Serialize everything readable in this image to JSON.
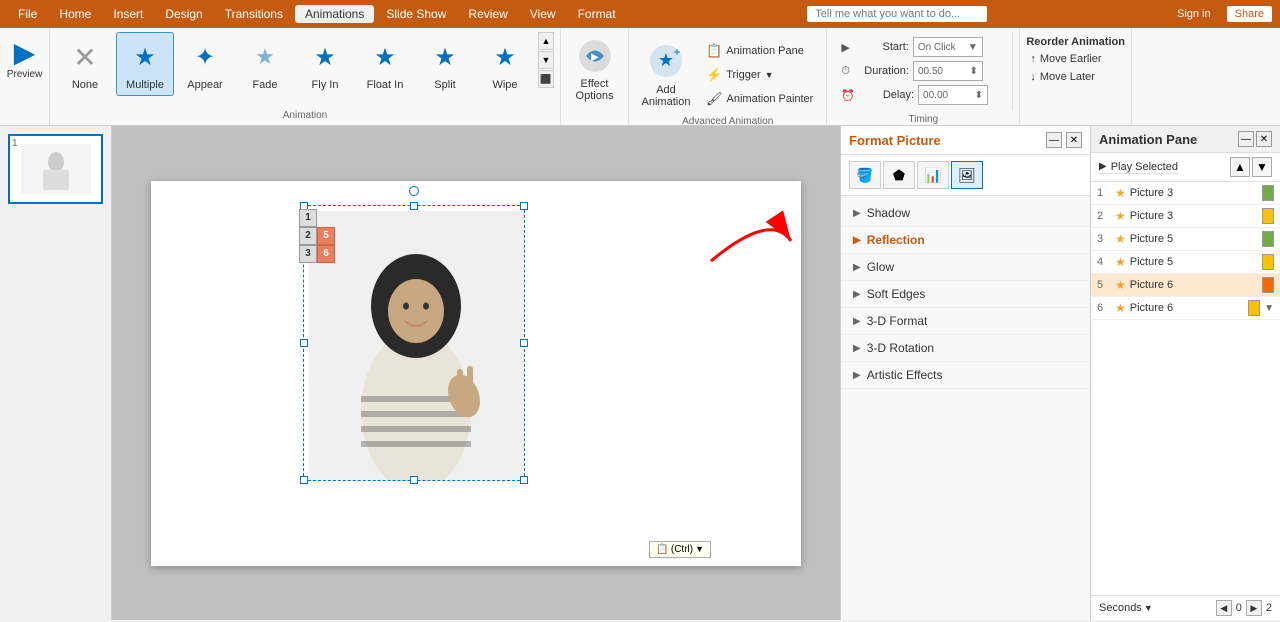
{
  "menubar": {
    "items": [
      "File",
      "Home",
      "Insert",
      "Design",
      "Transitions",
      "Animations",
      "Slide Show",
      "Review",
      "View",
      "Format"
    ],
    "active": "Animations",
    "search_placeholder": "Tell me what you want to do...",
    "signin": "Sign in",
    "share": "Share"
  },
  "ribbon": {
    "groups": {
      "preview": {
        "label": "Preview"
      },
      "animation": {
        "label": "Animation",
        "items": [
          {
            "id": "none",
            "label": "None",
            "icon": "✕"
          },
          {
            "id": "multiple",
            "label": "Multiple",
            "icon": "★",
            "selected": true
          },
          {
            "id": "appear",
            "label": "Appear",
            "icon": "✦"
          },
          {
            "id": "fade",
            "label": "Fade",
            "icon": "◈"
          },
          {
            "id": "fly-in",
            "label": "Fly In",
            "icon": "★"
          },
          {
            "id": "float-in",
            "label": "Float In",
            "icon": "★"
          },
          {
            "id": "split",
            "label": "Split",
            "icon": "★"
          },
          {
            "id": "wipe",
            "label": "Wipe",
            "icon": "★"
          }
        ]
      },
      "effect-options": {
        "label": "Effect Options"
      },
      "advanced": {
        "label": "Advanced Animation",
        "items": [
          {
            "id": "add-animation",
            "label": "Add Animation"
          },
          {
            "id": "animation-pane",
            "label": "Animation Pane"
          },
          {
            "id": "trigger",
            "label": "Trigger"
          },
          {
            "id": "animation-painter",
            "label": "Animation Painter"
          }
        ]
      },
      "timing": {
        "label": "Timing",
        "start_label": "Start:",
        "start_value": "On Click",
        "duration_label": "Duration:",
        "duration_value": "00.50",
        "delay_label": "Delay:",
        "delay_value": "00.00"
      },
      "reorder": {
        "title": "Reorder Animation",
        "move_earlier": "Move Earlier",
        "move_later": "Move Later"
      }
    }
  },
  "format_panel": {
    "title": "Format Picture",
    "sections": [
      {
        "id": "shadow",
        "label": "Shadow",
        "expanded": false,
        "bold": false
      },
      {
        "id": "reflection",
        "label": "Reflection",
        "expanded": false,
        "bold": true
      },
      {
        "id": "glow",
        "label": "Glow",
        "expanded": false,
        "bold": false
      },
      {
        "id": "soft-edges",
        "label": "Soft Edges",
        "expanded": false,
        "bold": false
      },
      {
        "id": "3d-format",
        "label": "3-D Format",
        "expanded": false,
        "bold": false
      },
      {
        "id": "3d-rotation",
        "label": "3-D Rotation",
        "expanded": false,
        "bold": false
      },
      {
        "id": "artistic-effects",
        "label": "Artistic Effects",
        "expanded": false,
        "bold": false
      }
    ]
  },
  "animation_pane": {
    "title": "Animation Pane",
    "play_selected": "Play Selected",
    "items": [
      {
        "num": "1",
        "name": "Picture 3",
        "color_class": "green-bar",
        "selected": false
      },
      {
        "num": "2",
        "name": "Picture 3",
        "color_class": "yellow-bar",
        "selected": false
      },
      {
        "num": "3",
        "name": "Picture 5",
        "color_class": "green-bar",
        "selected": false
      },
      {
        "num": "4",
        "name": "Picture 5",
        "color_class": "yellow-bar",
        "selected": false
      },
      {
        "num": "5",
        "name": "Picture 6",
        "color_class": "orange-bar",
        "selected": true
      },
      {
        "num": "6",
        "name": "Picture 6",
        "color_class": "yellow-bar",
        "selected": false,
        "has_arrow": true
      }
    ],
    "footer": {
      "seconds_label": "Seconds",
      "page_prev": "◀",
      "page_current": "0",
      "page_next": "2"
    }
  },
  "slide": {
    "num": 1,
    "ctrl_label": "(Ctrl)"
  },
  "icons": {
    "fill": "🪣",
    "shape": "⬟",
    "effects": "📊",
    "picture": "🖼"
  }
}
